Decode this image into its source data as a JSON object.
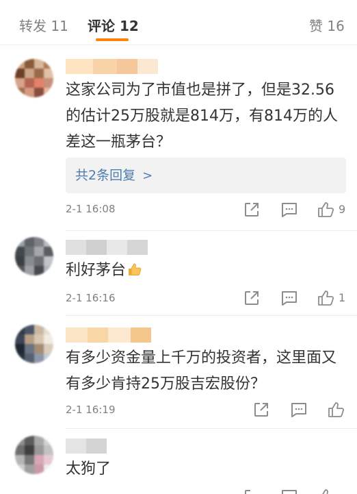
{
  "tabs": {
    "repost": "转发 11",
    "comments": "评论 12",
    "likes": "赞 16"
  },
  "comments": [
    {
      "text": "这家公司为了市值也是拼了，但是32.56的估计25万股就是814万，有814万的人差这一瓶茅台？",
      "replies_label": "共2条回复",
      "time": "2-1 16:08",
      "like_count": "9"
    },
    {
      "text": "利好茅台",
      "time": "2-1 16:16",
      "like_count": "1"
    },
    {
      "text": "有多少资金量上千万的投资者，这里面又有多少肯持25万股吉宏股份？",
      "time": "2-1 16:19",
      "like_count": ""
    },
    {
      "text": "太狗了"
    }
  ],
  "colors": {
    "accent": "#ff8200",
    "link": "#4f7cae",
    "muted": "#808080",
    "icon": "#8c8c8c"
  },
  "icons": [
    "share-icon",
    "comment-icon",
    "like-icon",
    "thumbs-up-emoji"
  ]
}
